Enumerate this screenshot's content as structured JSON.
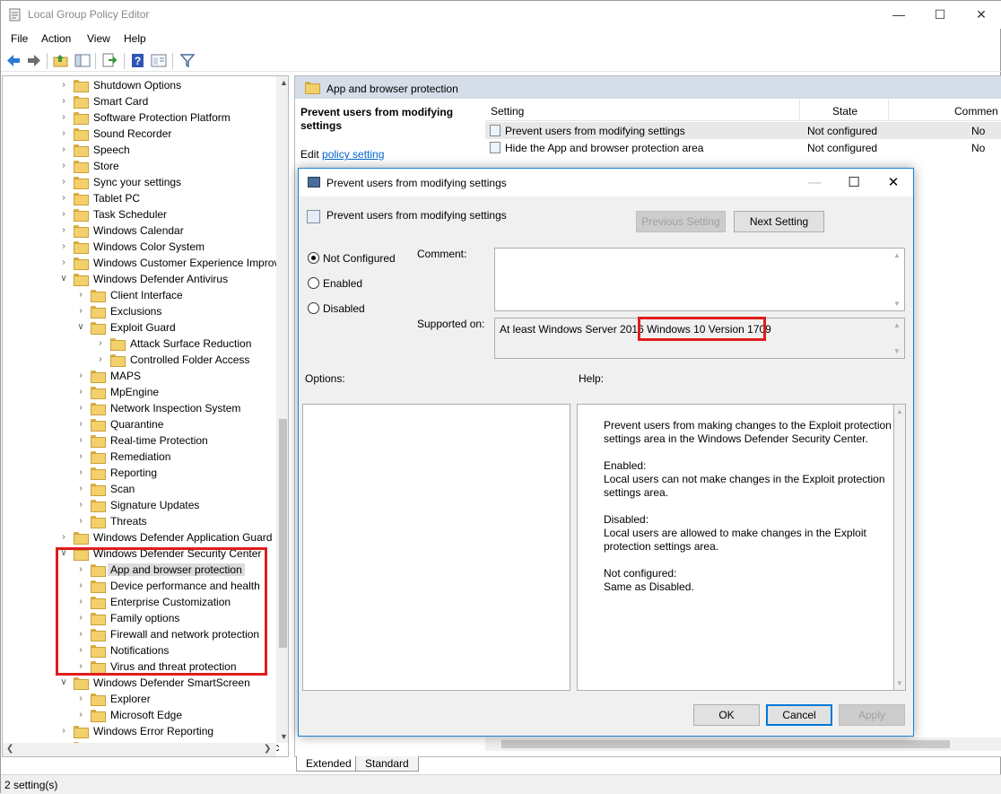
{
  "window": {
    "title": "Local Group Policy Editor"
  },
  "menu": [
    "File",
    "Action",
    "View",
    "Help"
  ],
  "tree": {
    "items": [
      {
        "label": "Shutdown Options",
        "level": 1,
        "exp": "collapsed"
      },
      {
        "label": "Smart Card",
        "level": 1,
        "exp": "collapsed"
      },
      {
        "label": "Software Protection Platform",
        "level": 1,
        "exp": "collapsed"
      },
      {
        "label": "Sound Recorder",
        "level": 1,
        "exp": "collapsed"
      },
      {
        "label": "Speech",
        "level": 1,
        "exp": "collapsed"
      },
      {
        "label": "Store",
        "level": 1,
        "exp": "collapsed"
      },
      {
        "label": "Sync your settings",
        "level": 1,
        "exp": "collapsed"
      },
      {
        "label": "Tablet PC",
        "level": 1,
        "exp": "collapsed"
      },
      {
        "label": "Task Scheduler",
        "level": 1,
        "exp": "collapsed"
      },
      {
        "label": "Windows Calendar",
        "level": 1,
        "exp": "collapsed"
      },
      {
        "label": "Windows Color System",
        "level": 1,
        "exp": "collapsed"
      },
      {
        "label": "Windows Customer Experience Improv",
        "level": 1,
        "exp": "collapsed"
      },
      {
        "label": "Windows Defender Antivirus",
        "level": 1,
        "exp": "expanded"
      },
      {
        "label": "Client Interface",
        "level": 2,
        "exp": "collapsed"
      },
      {
        "label": "Exclusions",
        "level": 2,
        "exp": "collapsed"
      },
      {
        "label": "Exploit Guard",
        "level": 2,
        "exp": "expanded"
      },
      {
        "label": "Attack Surface Reduction",
        "level": 3,
        "exp": "collapsed"
      },
      {
        "label": "Controlled Folder Access",
        "level": 3,
        "exp": "collapsed"
      },
      {
        "label": "MAPS",
        "level": 2,
        "exp": "collapsed"
      },
      {
        "label": "MpEngine",
        "level": 2,
        "exp": "collapsed"
      },
      {
        "label": "Network Inspection System",
        "level": 2,
        "exp": "collapsed"
      },
      {
        "label": "Quarantine",
        "level": 2,
        "exp": "collapsed"
      },
      {
        "label": "Real-time Protection",
        "level": 2,
        "exp": "collapsed"
      },
      {
        "label": "Remediation",
        "level": 2,
        "exp": "collapsed"
      },
      {
        "label": "Reporting",
        "level": 2,
        "exp": "collapsed"
      },
      {
        "label": "Scan",
        "level": 2,
        "exp": "collapsed"
      },
      {
        "label": "Signature Updates",
        "level": 2,
        "exp": "collapsed"
      },
      {
        "label": "Threats",
        "level": 2,
        "exp": "collapsed"
      },
      {
        "label": "Windows Defender Application Guard",
        "level": 1,
        "exp": "collapsed"
      },
      {
        "label": "Windows Defender Security Center",
        "level": 1,
        "exp": "expanded"
      },
      {
        "label": "App and browser protection",
        "level": 2,
        "exp": "collapsed",
        "selected": true
      },
      {
        "label": "Device performance and health",
        "level": 2,
        "exp": "collapsed"
      },
      {
        "label": "Enterprise Customization",
        "level": 2,
        "exp": "collapsed"
      },
      {
        "label": "Family options",
        "level": 2,
        "exp": "collapsed"
      },
      {
        "label": "Firewall and network protection",
        "level": 2,
        "exp": "collapsed"
      },
      {
        "label": "Notifications",
        "level": 2,
        "exp": "collapsed"
      },
      {
        "label": "Virus and threat protection",
        "level": 2,
        "exp": "collapsed"
      },
      {
        "label": "Windows Defender SmartScreen",
        "level": 1,
        "exp": "expanded"
      },
      {
        "label": "Explorer",
        "level": 2,
        "exp": "collapsed"
      },
      {
        "label": "Microsoft Edge",
        "level": 2,
        "exp": "collapsed"
      },
      {
        "label": "Windows Error Reporting",
        "level": 1,
        "exp": "collapsed"
      },
      {
        "label": "Windows Game Recording and Broadc",
        "level": 1,
        "exp": "collapsed"
      }
    ]
  },
  "right": {
    "header": "App and browser protection",
    "desc_title": "Prevent users from modifying settings",
    "edit_prefix": "Edit",
    "edit_link": "policy setting",
    "columns": [
      "Setting",
      "State",
      "Commen"
    ],
    "rows": [
      {
        "setting": "Prevent users from modifying settings",
        "state": "Not configured",
        "comment": "No"
      },
      {
        "setting": "Hide the App and browser protection area",
        "state": "Not configured",
        "comment": "No"
      }
    ]
  },
  "tabs": [
    "Extended",
    "Standard"
  ],
  "status": "2 setting(s)",
  "dialog": {
    "title": "Prevent users from modifying settings",
    "heading": "Prevent users from modifying settings",
    "prev_btn": "Previous Setting",
    "next_btn": "Next Setting",
    "radios": [
      "Not Configured",
      "Enabled",
      "Disabled"
    ],
    "selected_radio": "Not Configured",
    "comment_label": "Comment:",
    "supported_label": "Supported on:",
    "supported_a": "At least Windows Server 2016",
    "supported_b": "Windows 10 Version 1709",
    "options_label": "Options:",
    "help_label": "Help:",
    "help": [
      "Prevent users from making changes to the Exploit protection settings area in the Windows Defender Security Center.",
      "Enabled:",
      "Local users can not make changes in the Exploit protection settings area.",
      "Disabled:",
      "Local users are allowed to make changes in the Exploit protection settings area.",
      "Not configured:",
      "Same as Disabled."
    ],
    "ok": "OK",
    "cancel": "Cancel",
    "apply": "Apply"
  },
  "highlight_color": "#e01c1c"
}
